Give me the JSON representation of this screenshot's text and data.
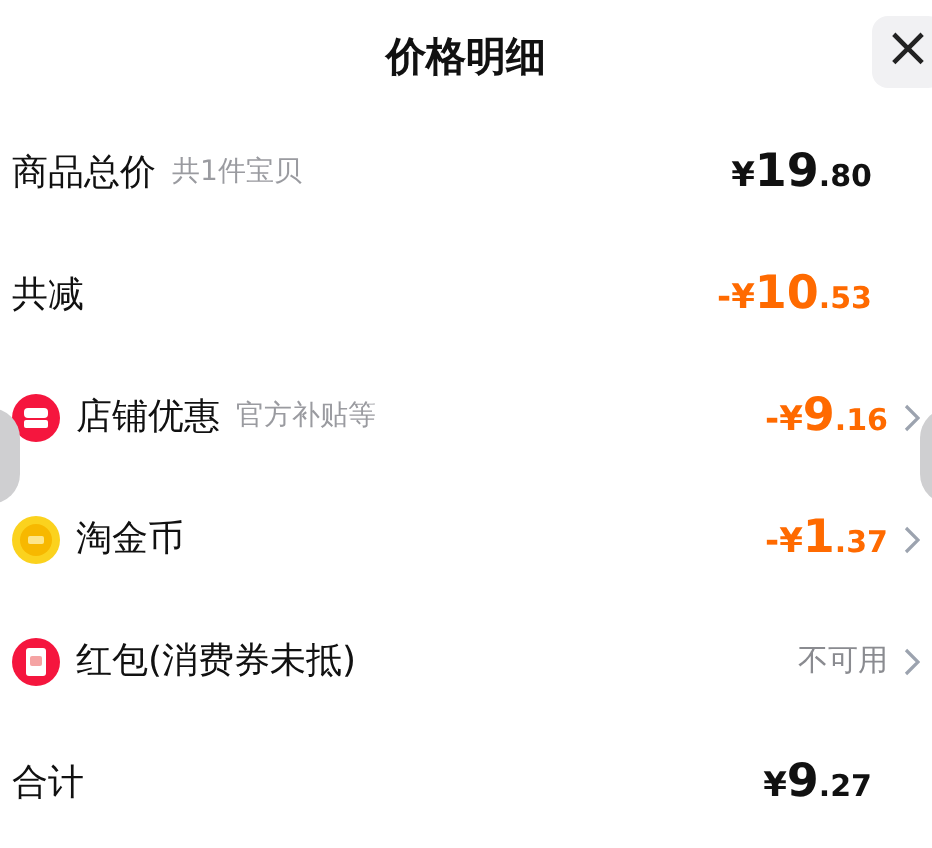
{
  "header": {
    "title": "价格明细",
    "close": "×"
  },
  "rows": [
    {
      "kind": "subtotal",
      "label": "商品总价",
      "note": "共1件宝贝",
      "sign": "¥",
      "whole": "19",
      "fraction": ".80"
    },
    {
      "kind": "reduction",
      "label": "共减",
      "sign": "-¥",
      "whole": "10",
      "fraction": ".53"
    },
    {
      "kind": "store_discount",
      "label": "店铺优惠",
      "note": "官方补贴等",
      "sign": "-¥",
      "whole": "9",
      "fraction": ".16"
    },
    {
      "kind": "coin",
      "label": "淘金币",
      "sign": "-¥",
      "whole": "1",
      "fraction": ".37"
    },
    {
      "kind": "red_packet",
      "label": "红包(消费券未抵)",
      "status": "不可用"
    },
    {
      "kind": "total",
      "label": "合计",
      "sign": "¥",
      "whole": "9",
      "fraction": ".27"
    }
  ]
}
